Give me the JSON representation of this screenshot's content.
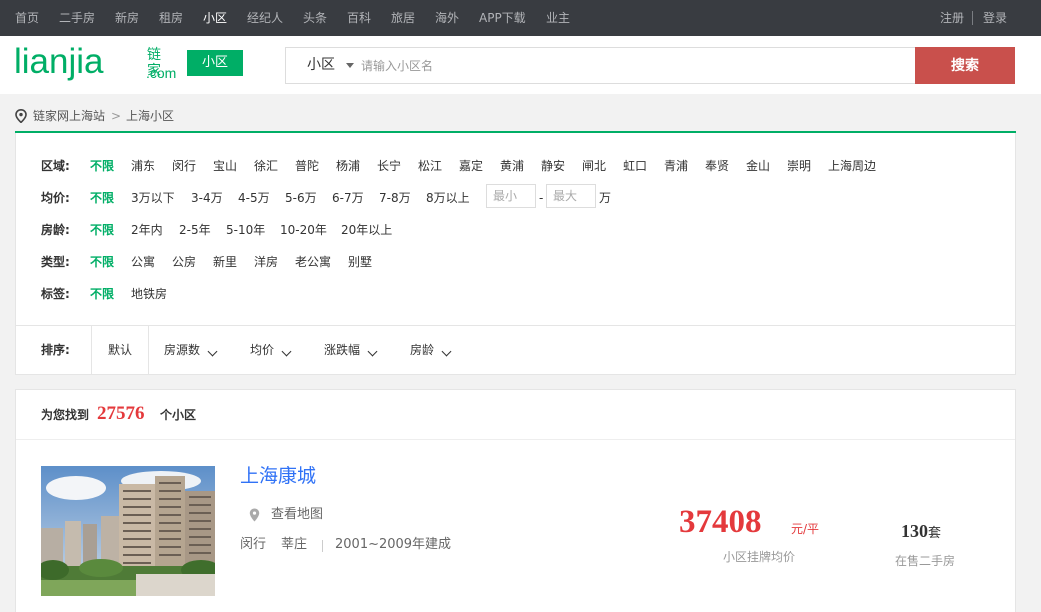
{
  "topnav": {
    "items": [
      "首页",
      "二手房",
      "新房",
      "租房",
      "小区",
      "经纪人",
      "头条",
      "百科",
      "旅居",
      "海外",
      "APP下载",
      "业主"
    ],
    "active": "小区",
    "register": "注册",
    "login": "登录"
  },
  "header": {
    "logo_text": "lianjia",
    "logo_cn": "链家",
    "logo_com": ".com",
    "channel": "小区",
    "search_type": "小区",
    "search_placeholder": "请输入小区名",
    "search_button": "搜索"
  },
  "breadcrumb": {
    "items": [
      "链家网上海站",
      "上海小区"
    ],
    "separator": ">"
  },
  "filters": {
    "district": {
      "label": "区域:",
      "options": [
        "不限",
        "浦东",
        "闵行",
        "宝山",
        "徐汇",
        "普陀",
        "杨浦",
        "长宁",
        "松江",
        "嘉定",
        "黄浦",
        "静安",
        "闸北",
        "虹口",
        "青浦",
        "奉贤",
        "金山",
        "崇明",
        "上海周边"
      ]
    },
    "price": {
      "label": "均价:",
      "options": [
        "不限",
        "3万以下",
        "3-4万",
        "4-5万",
        "5-6万",
        "6-7万",
        "7-8万",
        "8万以上"
      ],
      "min_placeholder": "最小",
      "max_placeholder": "最大",
      "dash": "-",
      "unit": "万"
    },
    "age": {
      "label": "房龄:",
      "options": [
        "不限",
        "2年内",
        "2-5年",
        "5-10年",
        "10-20年",
        "20年以上"
      ]
    },
    "type": {
      "label": "类型:",
      "options": [
        "不限",
        "公寓",
        "公房",
        "新里",
        "洋房",
        "老公寓",
        "别墅"
      ]
    },
    "tag": {
      "label": "标签:",
      "options": [
        "不限",
        "地铁房"
      ]
    },
    "selected_color": "#00ae66"
  },
  "sort": {
    "label": "排序:",
    "default": "默认",
    "options": [
      "房源数",
      "均价",
      "涨跌幅",
      "房龄"
    ]
  },
  "results": {
    "prefix": "为您找到",
    "count": "27576",
    "suffix": "个小区"
  },
  "listing": {
    "title": "上海康城",
    "map_link": "查看地图",
    "district": "闵行",
    "area": "莘庄",
    "built": "2001~2009年建成",
    "price": "37408",
    "price_unit": "元/平",
    "price_desc": "小区挂牌均价",
    "on_sale": "130",
    "on_sale_unit": "套",
    "on_sale_desc": "在售二手房"
  },
  "colors": {
    "brand_green": "#00ae66",
    "price_red": "#e4393c",
    "search_button": "#c9504c",
    "topnav_bg": "#393c41",
    "link_blue": "#3072f6"
  }
}
